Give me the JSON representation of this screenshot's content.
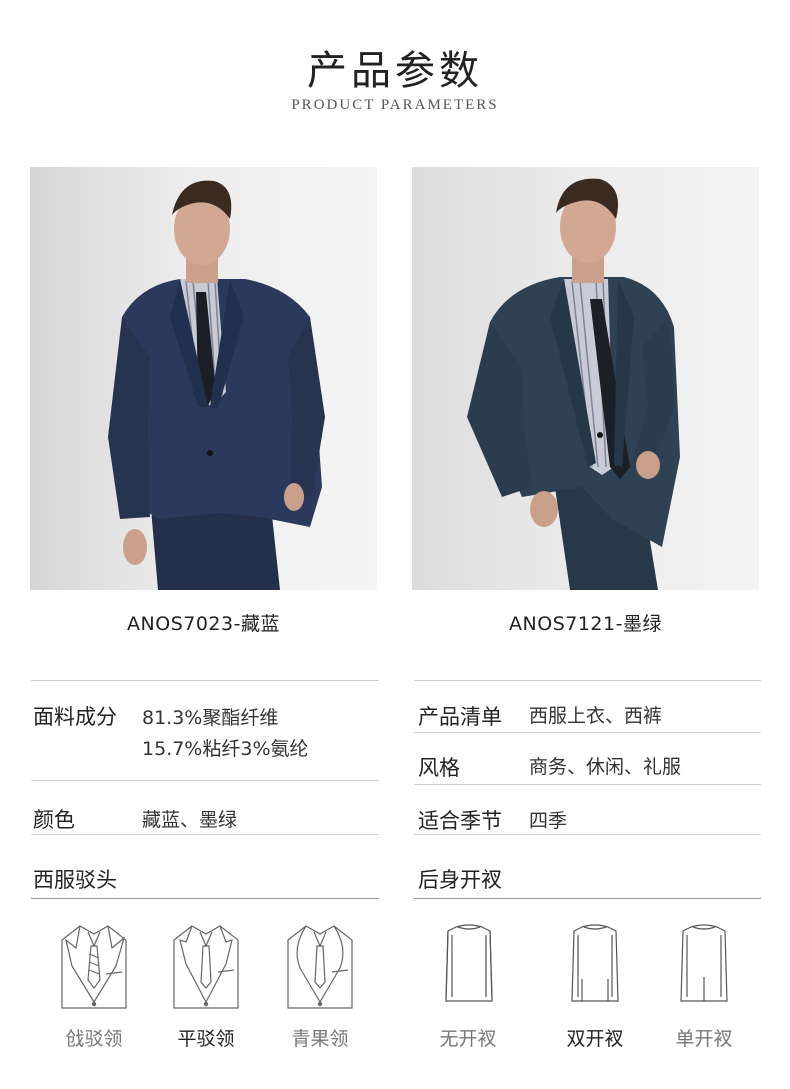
{
  "header": {
    "title_zh": "产品参数",
    "title_en": "PRODUCT PARAMETERS"
  },
  "products": [
    {
      "caption": "ANOS7023-藏蓝",
      "suit_color": "#283552"
    },
    {
      "caption": "ANOS7121-墨绿",
      "suit_color": "#2b3d4e"
    }
  ],
  "params": {
    "fabric_label": "面料成分",
    "fabric_line1": "81.3%聚酯纤维",
    "fabric_line2": "15.7%粘纤3%氨纶",
    "color_label": "颜色",
    "color_value": "藏蓝、墨绿",
    "list_label": "产品清单",
    "list_value": "西服上衣、西裤",
    "style_label": "风格",
    "style_value": "商务、休闲、礼服",
    "season_label": "适合季节",
    "season_value": "四季"
  },
  "lapel": {
    "title": "西服驳头",
    "options": [
      "戗驳领",
      "平驳领",
      "青果领"
    ],
    "selected": "平驳领"
  },
  "vent": {
    "title": "后身开衩",
    "options": [
      "无开衩",
      "双开衩",
      "单开衩"
    ],
    "selected": "双开衩"
  }
}
